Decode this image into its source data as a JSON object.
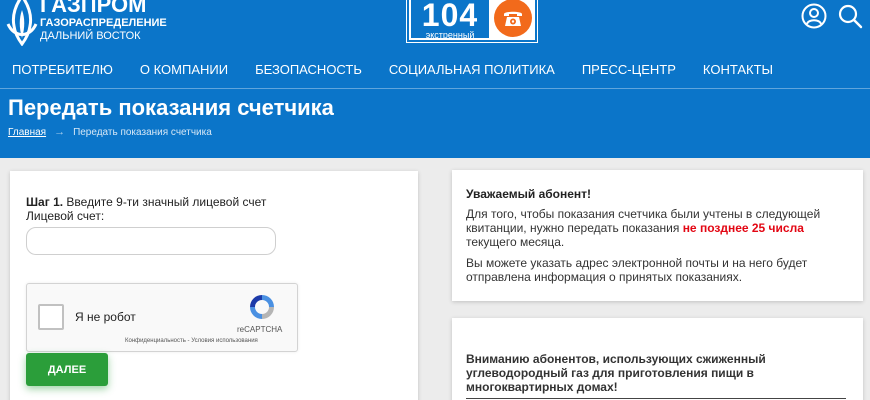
{
  "header": {
    "logo": {
      "brand": "ГАЗПРОМ",
      "line1": "ГАЗОРАСПРЕДЕЛЕНИЕ",
      "line2": "ДАЛЬНИЙ ВОСТОК"
    },
    "hotline": {
      "number": "104",
      "label": "экстренный"
    },
    "icons": [
      "user-icon",
      "search-icon"
    ]
  },
  "nav": [
    {
      "label": "ПОТРЕБИТЕЛЮ"
    },
    {
      "label": "О КОМПАНИИ"
    },
    {
      "label": "БЕЗОПАСНОСТЬ"
    },
    {
      "label": "СОЦИАЛЬНАЯ ПОЛИТИКА"
    },
    {
      "label": "ПРЕСС-ЦЕНТР"
    },
    {
      "label": "КОНТАКТЫ"
    }
  ],
  "page": {
    "title": "Передать показания счетчика",
    "breadcrumb": {
      "home": "Главная",
      "separator": "→",
      "current": "Передать показания счетчика"
    }
  },
  "form": {
    "step_bold": "Шаг 1.",
    "step_text": " Введите 9-ти значный лицевой счет",
    "account_label": "Лицевой счет:",
    "account_value": "",
    "account_placeholder": "",
    "captcha": {
      "label": "Я не робот",
      "brand": "reCAPTCHA",
      "links": "Конфиденциальность - Условия использования"
    },
    "next_button": "ДАЛЕЕ"
  },
  "info": {
    "title": "Уважаемый абонент!",
    "p1_before": "Для того, чтобы показания счетчика были учтены в следующей квитанции, нужно передать показания ",
    "p1_red": "не позднее 25 числа",
    "p1_after": " текущего месяца.",
    "p2": "Вы можете указать адрес электронной почты и на него будет отправлена информация о принятых показаниях."
  },
  "lpg_notice": {
    "title": "Вниманию абонентов, использующих сжиженный углеводородный газ для приготовления пищи в многоквартирных домах!"
  },
  "colors": {
    "brand_blue": "#0b75c9",
    "accent_red": "#e30613",
    "button_green": "#2b9e3a",
    "phone_orange": "#f26a1b"
  }
}
